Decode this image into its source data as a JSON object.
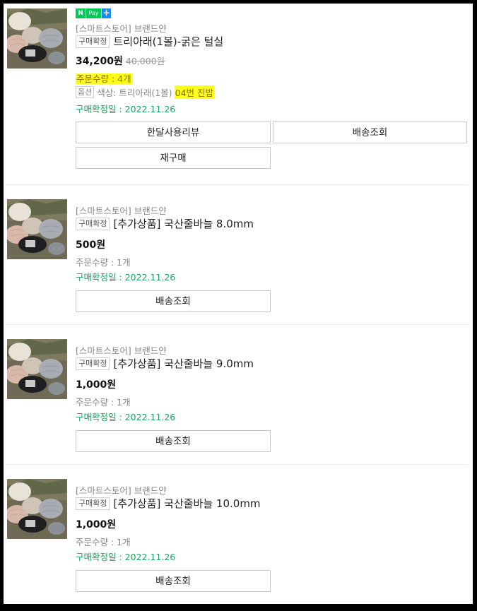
{
  "orders": [
    {
      "store": "[스마트스토어] 브랜드얀",
      "status_badge": "구매확정",
      "title": "트리아래(1볼)-굵은 털실",
      "price": "34,200원",
      "original_price": "40,000원",
      "quantity": "주문수량 : 4개",
      "option_badge": "옵션",
      "option_prefix": "색상: 트리아래(1볼)",
      "option_highlight": "04번 진밤",
      "confirm_date": "구매확정일 : 2022.11.26",
      "npay": {
        "n": "N",
        "pay": "Pay",
        "plus": "+"
      },
      "buttons": [
        "한달사용리뷰",
        "배송조회",
        "재구매"
      ]
    },
    {
      "store": "[스마트스토어] 브랜드얀",
      "status_badge": "구매확정",
      "title": "[추가상품] 국산줄바늘 8.0mm",
      "price": "500원",
      "quantity": "주문수량 : 1개",
      "confirm_date": "구매확정일 : 2022.11.26",
      "buttons": [
        "배송조회"
      ]
    },
    {
      "store": "[스마트스토어] 브랜드얀",
      "status_badge": "구매확정",
      "title": "[추가상품] 국산줄바늘 9.0mm",
      "price": "1,000원",
      "quantity": "주문수량 : 1개",
      "confirm_date": "구매확정일 : 2022.11.26",
      "buttons": [
        "배송조회"
      ]
    },
    {
      "store": "[스마트스토어] 브랜드얀",
      "status_badge": "구매확정",
      "title": "[추가상품] 국산줄바늘 10.0mm",
      "price": "1,000원",
      "quantity": "주문수량 : 1개",
      "confirm_date": "구매확정일 : 2022.11.26",
      "buttons": [
        "배송조회"
      ]
    }
  ],
  "colors": {
    "green": "#1ea362",
    "highlight": "#ffff1a",
    "npay_green": "#03c75a",
    "npay_blue": "#1e8ae6"
  },
  "icons": [
    "yarn-product-thumbnail",
    "npay-plus-icon"
  ]
}
